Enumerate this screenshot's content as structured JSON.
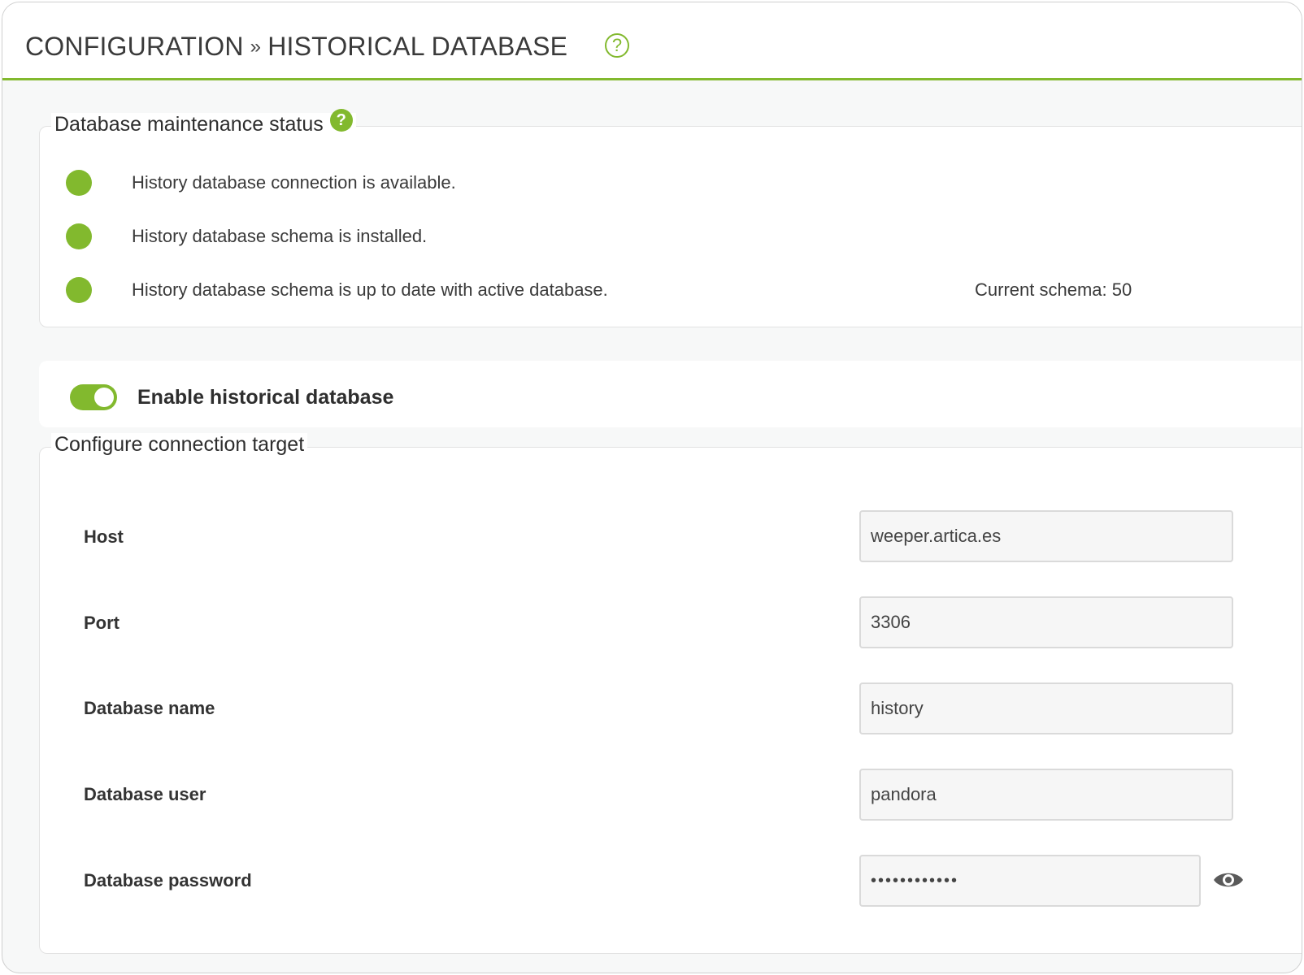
{
  "header": {
    "breadcrumb_parent": "CONFIGURATION",
    "breadcrumb_separator": "»",
    "breadcrumb_current": "HISTORICAL DATABASE",
    "help_glyph": "?"
  },
  "maintenance": {
    "title": "Database maintenance status",
    "help_glyph": "?",
    "items": [
      {
        "status": "ok",
        "text": "History database connection is available."
      },
      {
        "status": "ok",
        "text": "History database schema is installed."
      },
      {
        "status": "ok",
        "text": "History database schema is up to date with active database."
      }
    ],
    "current_schema": "Current schema: 50"
  },
  "toggle": {
    "label": "Enable historical database",
    "enabled": true
  },
  "connection": {
    "title": "Configure connection target",
    "fields": {
      "host": {
        "label": "Host",
        "value": "weeper.artica.es"
      },
      "port": {
        "label": "Port",
        "value": "3306"
      },
      "db_name": {
        "label": "Database name",
        "value": "history"
      },
      "db_user": {
        "label": "Database user",
        "value": "pandora"
      },
      "db_password": {
        "label": "Database password",
        "value": "............"
      }
    }
  },
  "colors": {
    "accent": "#82b92e",
    "background": "#f7f8f8"
  },
  "icons": {
    "status": "green-dot-icon",
    "help": "question-circle-icon",
    "reveal_password": "eye-icon"
  }
}
